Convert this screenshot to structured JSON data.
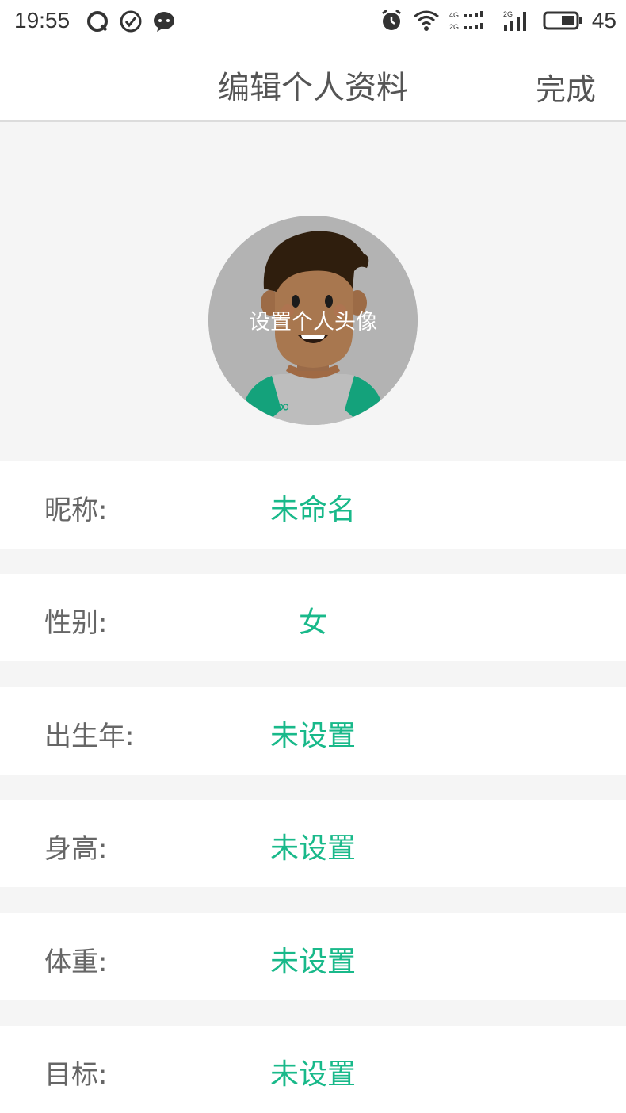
{
  "status": {
    "time": "19:55",
    "battery_pct": "45",
    "network_top": "4G",
    "network_bottom": "2G",
    "network2": "2G"
  },
  "header": {
    "title": "编辑个人资料",
    "done_label": "完成"
  },
  "avatar": {
    "label": "设置个人头像"
  },
  "profile": {
    "fields": [
      {
        "label": "昵称:",
        "value": "未命名"
      },
      {
        "label": "性别:",
        "value": "女"
      },
      {
        "label": "出生年:",
        "value": "未设置"
      },
      {
        "label": "身高:",
        "value": "未设置"
      },
      {
        "label": "体重:",
        "value": "未设置"
      },
      {
        "label": "目标:",
        "value": "未设置"
      }
    ]
  },
  "colors": {
    "accent": "#19b98a",
    "background": "#f5f5f5",
    "row_background": "#ffffff",
    "label_text": "#666666"
  }
}
